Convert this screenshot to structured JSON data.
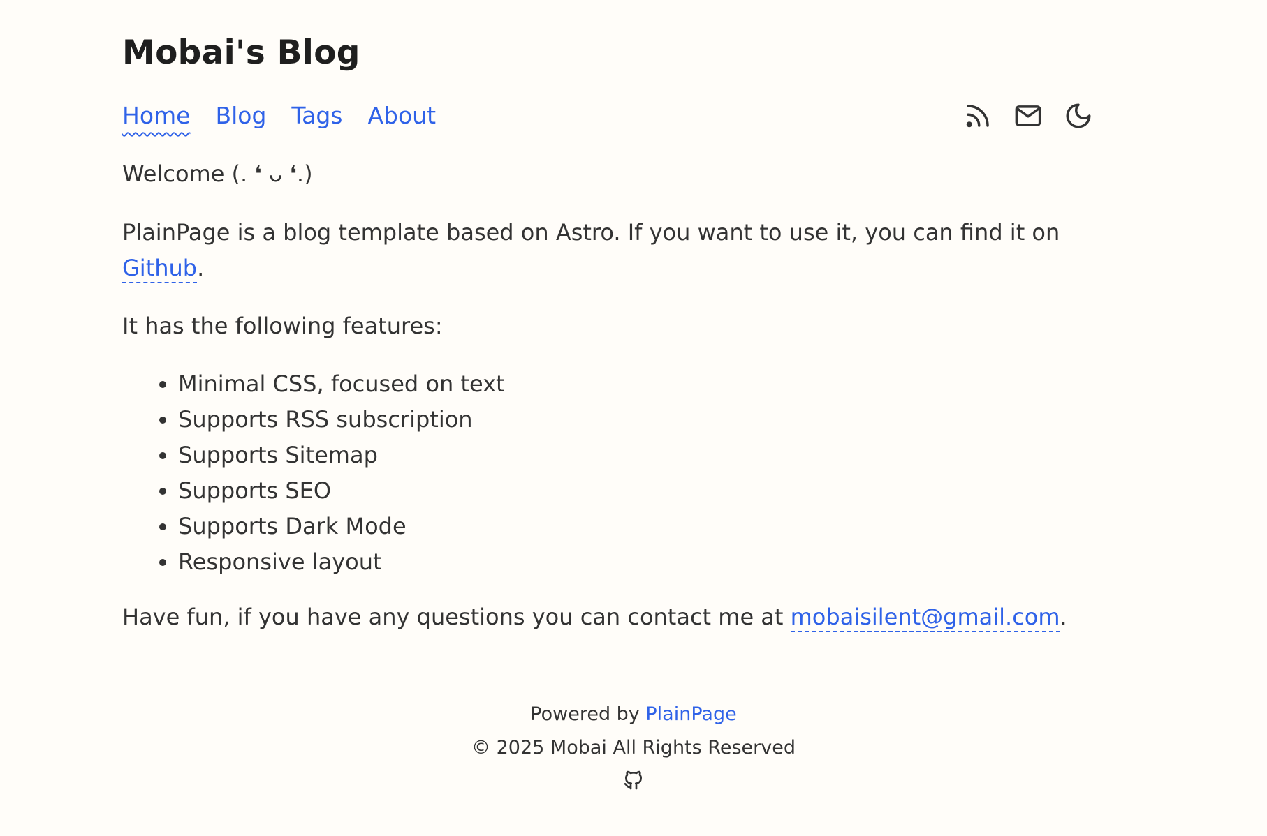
{
  "site": {
    "title": "Mobai's Blog"
  },
  "nav": {
    "links": [
      {
        "label": "Home",
        "active": true
      },
      {
        "label": "Blog",
        "active": false
      },
      {
        "label": "Tags",
        "active": false
      },
      {
        "label": "About",
        "active": false
      }
    ],
    "icons": [
      "rss-icon",
      "mail-icon",
      "moon-icon"
    ]
  },
  "content": {
    "welcome": "Welcome (. ❛ ᴗ ❛.)",
    "intro_text": "PlainPage is a blog template based on Astro. If you want to use it, you can find it on",
    "intro_link": "Github",
    "intro_end": ".",
    "features_lead": "It has the following features:",
    "features": [
      "Minimal CSS, focused on text",
      "Supports RSS subscription",
      "Supports Sitemap",
      "Supports SEO",
      "Supports Dark Mode",
      "Responsive layout"
    ],
    "contact_text": "Have fun, if you have any questions you can contact me at",
    "contact_email": "mobaisilent@gmail.com",
    "contact_end": "."
  },
  "footer": {
    "powered_by": "Powered by",
    "powered_link": "PlainPage",
    "copyright": "© 2025 Mobai All Rights Reserved",
    "icon": "github-icon"
  },
  "colors": {
    "background": "#fffdf9",
    "text": "#333333",
    "link": "#2f62e8",
    "title": "#1f1f1f"
  }
}
